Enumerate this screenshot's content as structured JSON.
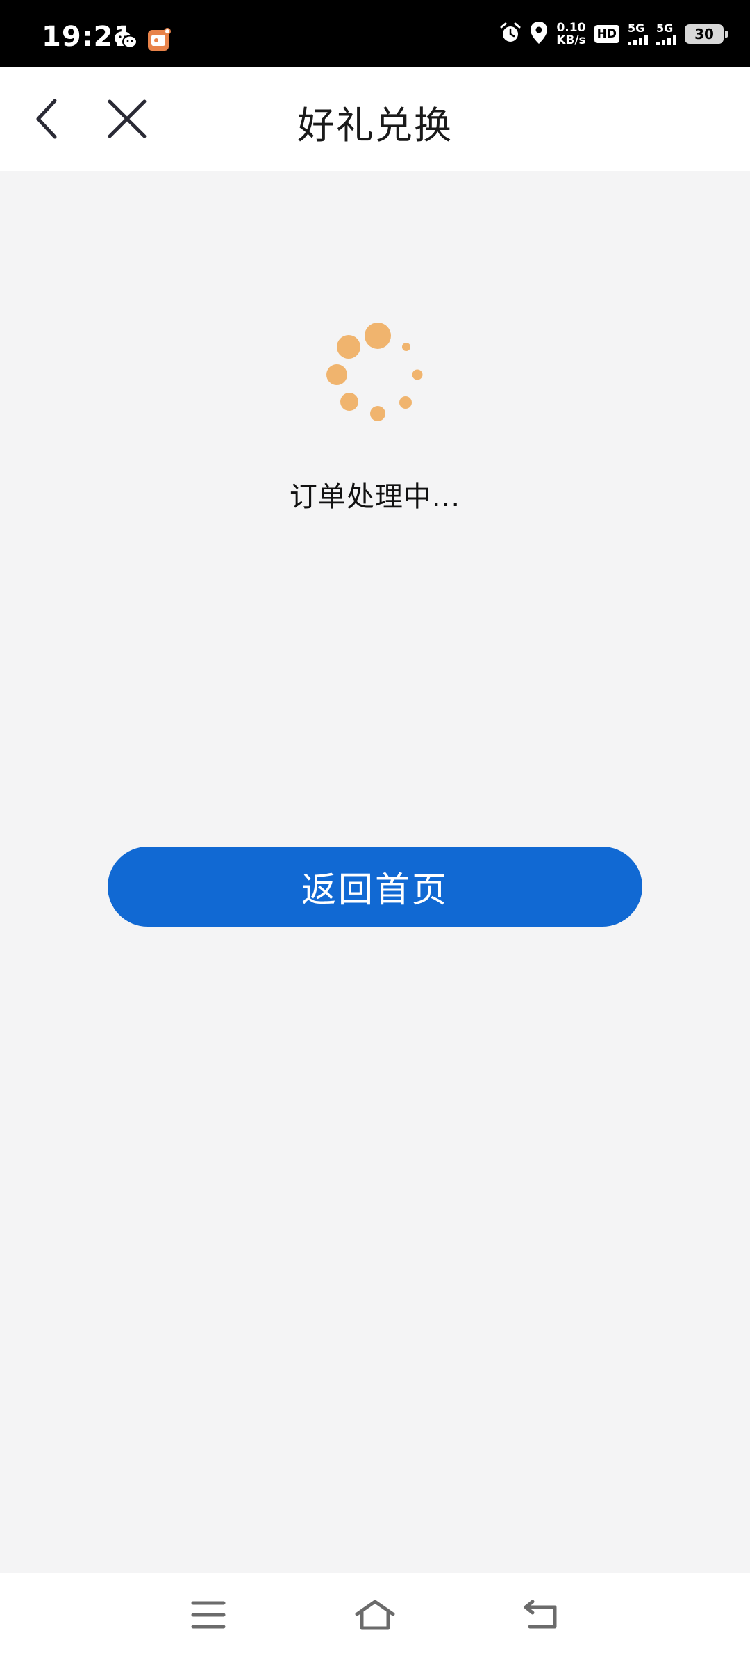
{
  "status_bar": {
    "time": "19:21",
    "net_speed_value": "0.10",
    "net_speed_unit": "KB/s",
    "hd_label": "HD",
    "sim1_label": "5G",
    "sim2_label": "5G",
    "battery_level": "30"
  },
  "header": {
    "title": "好礼兑换"
  },
  "main": {
    "status_text": "订单处理中...",
    "home_button_label": "返回首页",
    "spinner_color": "#f0b46e",
    "button_color": "#1169d3"
  }
}
